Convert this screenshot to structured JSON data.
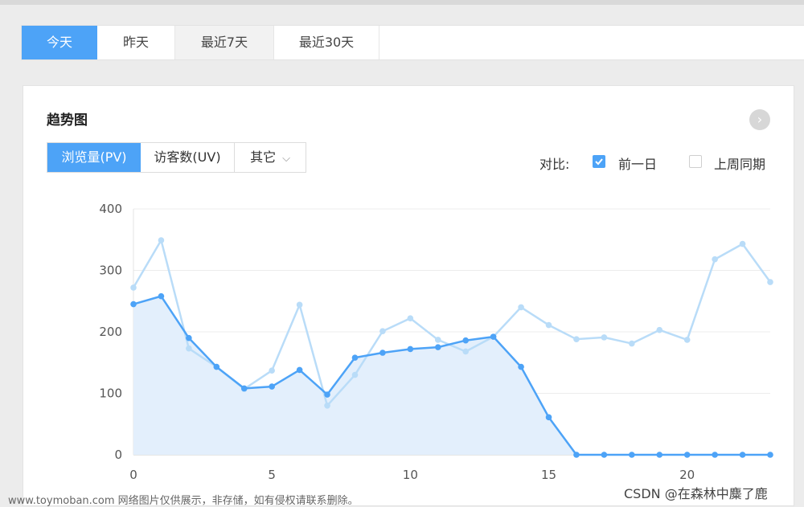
{
  "period_tabs": [
    "今天",
    "昨天",
    "最近7天",
    "最近30天"
  ],
  "card": {
    "title": "趋势图",
    "metric_tabs": [
      "浏览量(PV)",
      "访客数(UV)",
      "其它"
    ],
    "compare_label": "对比:",
    "compare_options": [
      {
        "label": "前一日",
        "checked": true
      },
      {
        "label": "上周同期",
        "checked": false
      }
    ]
  },
  "colors": {
    "accent": "#4da3f7",
    "series_today": "#4da3f7",
    "series_yesterday": "#b9dcf8",
    "area_fill": "#e3effc"
  },
  "chart_data": {
    "type": "line",
    "x": [
      0,
      1,
      2,
      3,
      4,
      5,
      6,
      7,
      8,
      9,
      10,
      11,
      12,
      13,
      14,
      15,
      16,
      17,
      18,
      19,
      20,
      21,
      22,
      23
    ],
    "series": [
      {
        "values": [
          245,
          258,
          190,
          143,
          108,
          111,
          138,
          98,
          158,
          166,
          172,
          175,
          186,
          192,
          143,
          61,
          0,
          0,
          0,
          0,
          0,
          0,
          0,
          0
        ]
      },
      {
        "values": [
          272,
          349,
          173,
          143,
          107,
          137,
          244,
          80,
          130,
          201,
          222,
          187,
          168,
          192,
          240,
          211,
          188,
          191,
          181,
          203,
          187,
          318,
          343,
          281
        ]
      }
    ],
    "x_ticks": [
      "0",
      "5",
      "10",
      "15",
      "20"
    ],
    "y_ticks": [
      "0",
      "100",
      "200",
      "300",
      "400"
    ],
    "ylim": [
      0,
      400
    ],
    "xlim": [
      0,
      23
    ],
    "grid": true
  },
  "watermark": {
    "left": "www.toymoban.com 网络图片仅供展示，非存储，如有侵权请联系删除。",
    "right": "CSDN @在森林中麋了鹿"
  }
}
